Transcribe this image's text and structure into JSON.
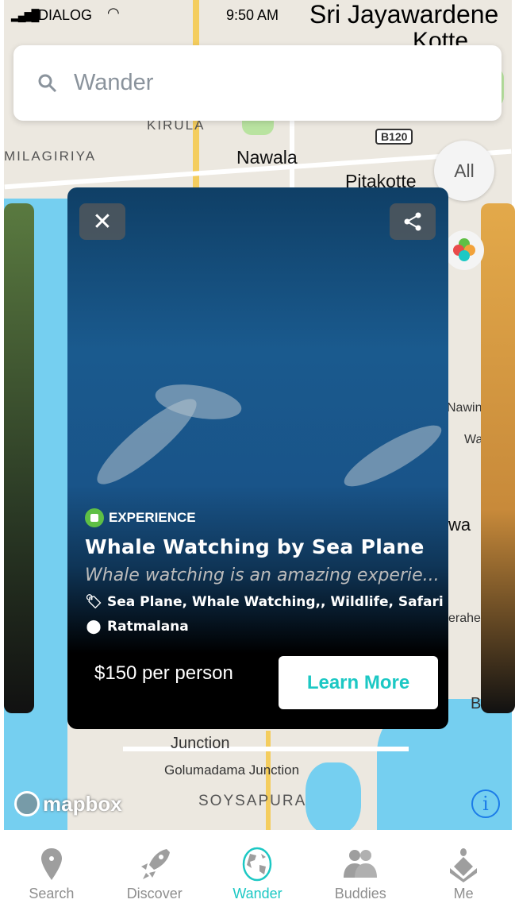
{
  "status": {
    "carrier": "DIALOG",
    "time": "9:50 AM"
  },
  "search": {
    "placeholder": "Wander",
    "icon": "search-icon"
  },
  "map": {
    "labels": [
      "Sri Jayawardene",
      "Kotte",
      "KIRULA",
      "MILAGIRIYA",
      "Nawala",
      "Pitakotte",
      "B120",
      "Nawinna",
      "Junction",
      "Golumadama Junction",
      "SOYSAPURA",
      "Boku",
      "erahera",
      "Watte",
      "wa"
    ],
    "attribution": "mapbox",
    "filter_label": "All"
  },
  "card": {
    "type": "EXPERIENCE",
    "title": "Whale Watching by Sea Plane",
    "description": "Whale watching is an amazing experie...",
    "tags": "Sea Plane, Whale Watching,, Wildlife, Safari",
    "location": "Ratmalana",
    "price": "$150 per person",
    "cta": "Learn More"
  },
  "tabs": [
    {
      "label": "Search",
      "icon": "map-pin-icon"
    },
    {
      "label": "Discover",
      "icon": "rocket-icon"
    },
    {
      "label": "Wander",
      "icon": "globe-icon",
      "active": true
    },
    {
      "label": "Buddies",
      "icon": "people-icon"
    },
    {
      "label": "Me",
      "icon": "user-icon"
    }
  ],
  "colors": {
    "accent": "#1cc8c4",
    "experience": "#5fbf45",
    "info": "#1c7ce8"
  }
}
